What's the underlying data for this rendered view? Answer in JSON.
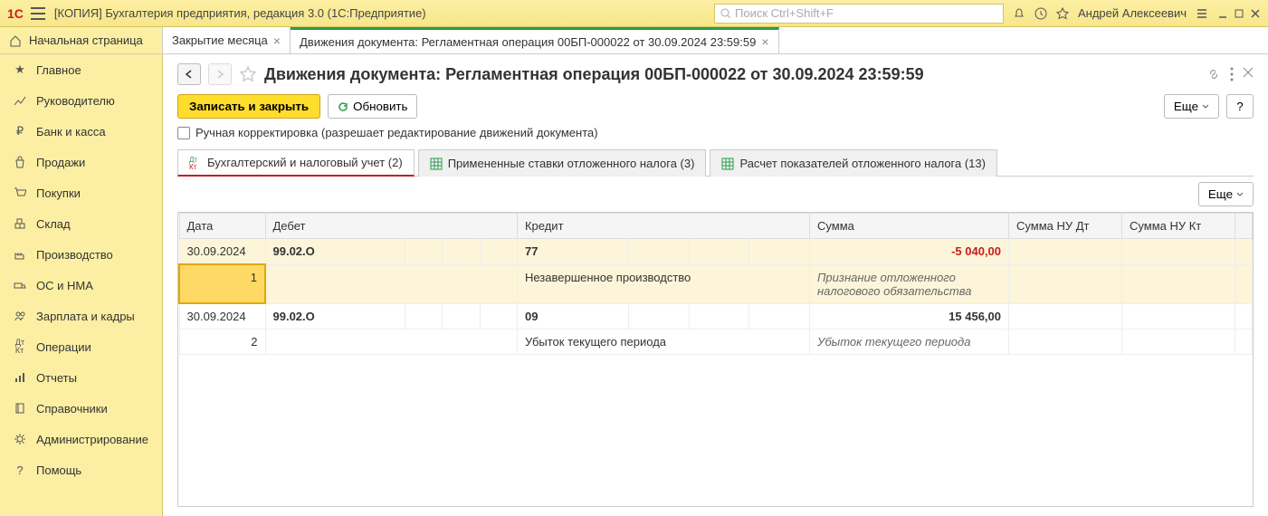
{
  "titlebar": {
    "app_title": "[КОПИЯ] Бухгалтерия предприятия, редакция 3.0  (1С:Предприятие)",
    "search_placeholder": "Поиск Ctrl+Shift+F",
    "user": "Андрей Алексеевич"
  },
  "tabs": {
    "home": "Начальная страница",
    "items": [
      {
        "label": "Закрытие месяца"
      },
      {
        "label": "Движения документа: Регламентная операция 00БП-000022 от 30.09.2024 23:59:59"
      }
    ]
  },
  "sidebar": {
    "items": [
      {
        "label": "Главное"
      },
      {
        "label": "Руководителю"
      },
      {
        "label": "Банк и касса"
      },
      {
        "label": "Продажи"
      },
      {
        "label": "Покупки"
      },
      {
        "label": "Склад"
      },
      {
        "label": "Производство"
      },
      {
        "label": "ОС и НМА"
      },
      {
        "label": "Зарплата и кадры"
      },
      {
        "label": "Операции"
      },
      {
        "label": "Отчеты"
      },
      {
        "label": "Справочники"
      },
      {
        "label": "Администрирование"
      },
      {
        "label": "Помощь"
      }
    ]
  },
  "page": {
    "title": "Движения документа: Регламентная операция 00БП-000022 от 30.09.2024 23:59:59",
    "save_close": "Записать и закрыть",
    "refresh": "Обновить",
    "more": "Еще",
    "help": "?",
    "manual_edit": "Ручная корректировка (разрешает редактирование движений документа)"
  },
  "subtabs": [
    {
      "label": "Бухгалтерский и налоговый учет (2)"
    },
    {
      "label": "Примененные ставки отложенного налога (3)"
    },
    {
      "label": "Расчет показателей отложенного налога (13)"
    }
  ],
  "grid": {
    "more": "Еще",
    "headers": {
      "date": "Дата",
      "debit": "Дебет",
      "credit": "Кредит",
      "sum": "Сумма",
      "sum_nu_dt": "Сумма НУ Дт",
      "sum_nu_kt": "Сумма НУ Кт"
    },
    "rows": [
      {
        "n": "1",
        "date": "30.09.2024",
        "debit": "99.02.О",
        "credit": "77",
        "credit_desc": "Незавершенное производство",
        "sum": "-5 040,00",
        "sum_desc": "Признание отложенного налогового обязательства",
        "negative": true
      },
      {
        "n": "2",
        "date": "30.09.2024",
        "debit": "99.02.О",
        "credit": "09",
        "credit_desc": "Убыток текущего периода",
        "sum": "15 456,00",
        "sum_desc": "Убыток текущего периода",
        "negative": false
      }
    ]
  }
}
